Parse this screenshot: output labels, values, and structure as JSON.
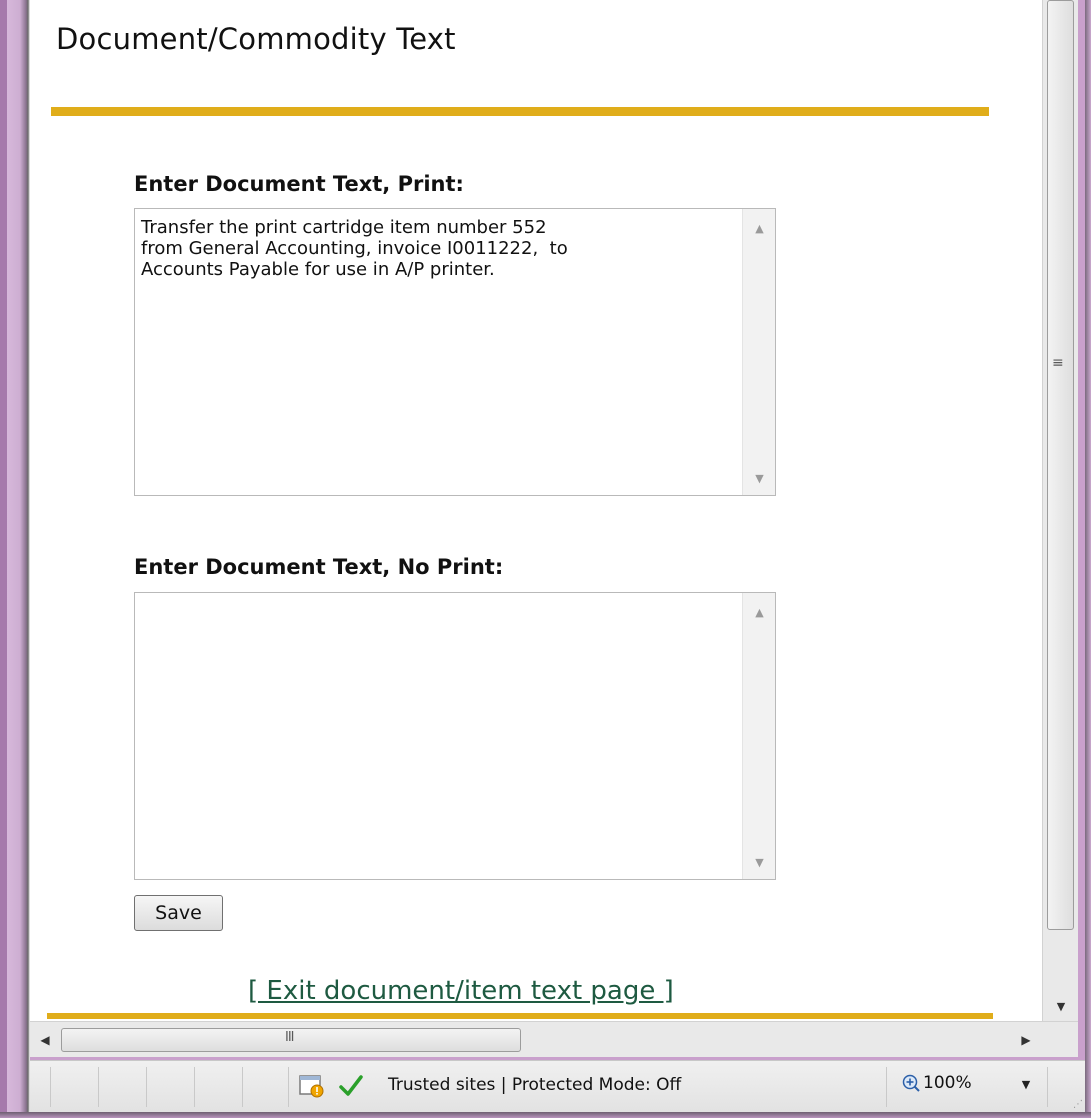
{
  "page": {
    "title": "Document/Commodity Text"
  },
  "print_field": {
    "label": "Enter Document Text, Print:",
    "value": "Transfer the print cartridge item number 552\nfrom General Accounting, invoice I0011222,  to\nAccounts Payable for use in A/P printer."
  },
  "noprint_field": {
    "label": "Enter Document Text, No Print:",
    "value": ""
  },
  "actions": {
    "save_label": "Save",
    "exit_link": "[ Exit document/item text page ]"
  },
  "scrollbars": {
    "up_arrow": "▲",
    "down_arrow": "▼",
    "left_arrow": "◀",
    "right_arrow": "▶",
    "vertical_grip": "≡",
    "horizontal_grip": "III"
  },
  "statusbar": {
    "zone_text": "Trusted sites | Protected Mode: Off",
    "zoom": "100%",
    "zoom_dropdown": "▼",
    "icons": [
      "page-warning-icon",
      "check-icon",
      "zoom-icon"
    ]
  },
  "colors": {
    "accent_rule": "#e0ad1a",
    "link": "#1e5a41",
    "check": "#2aa02a"
  }
}
